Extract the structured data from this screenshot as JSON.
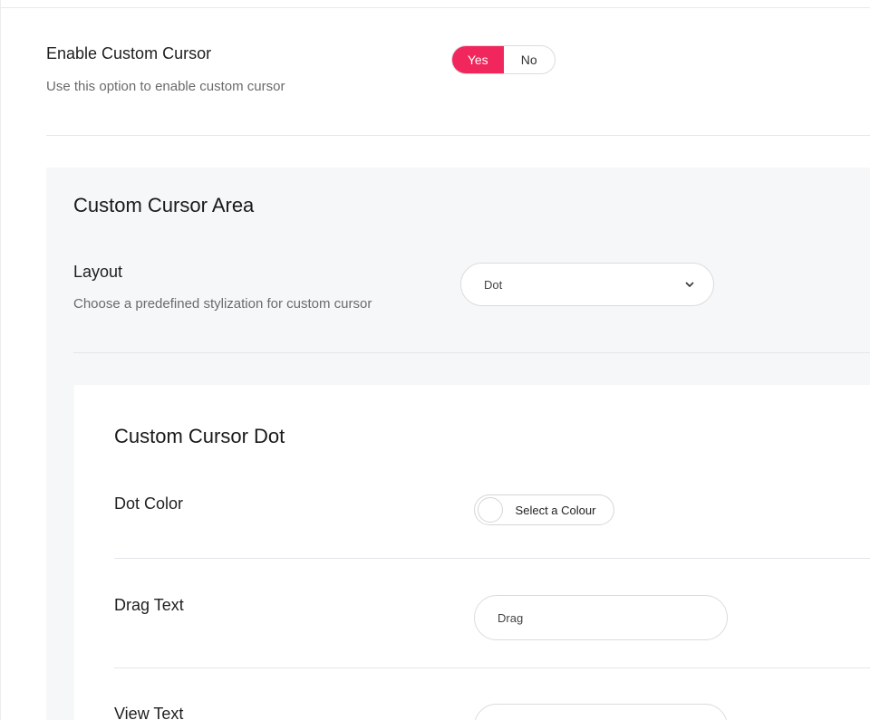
{
  "enable_cursor": {
    "title": "Enable Custom Cursor",
    "description": "Use this option to enable custom cursor",
    "toggle": {
      "yes_label": "Yes",
      "no_label": "No",
      "selected": "Yes"
    },
    "accent_color": "#f0265c"
  },
  "cursor_area": {
    "title": "Custom Cursor Area",
    "layout": {
      "title": "Layout",
      "description": "Choose a predefined stylization for custom cursor",
      "selected_value": "Dot",
      "icon": "chevron-down-icon"
    }
  },
  "cursor_dot": {
    "title": "Custom Cursor Dot",
    "dot_color": {
      "title": "Dot Color",
      "button_label": "Select a Colour",
      "swatch_color": "#ffffff"
    },
    "drag_text": {
      "title": "Drag Text",
      "value": "Drag"
    },
    "view_text": {
      "title": "View Text",
      "value": ""
    }
  }
}
